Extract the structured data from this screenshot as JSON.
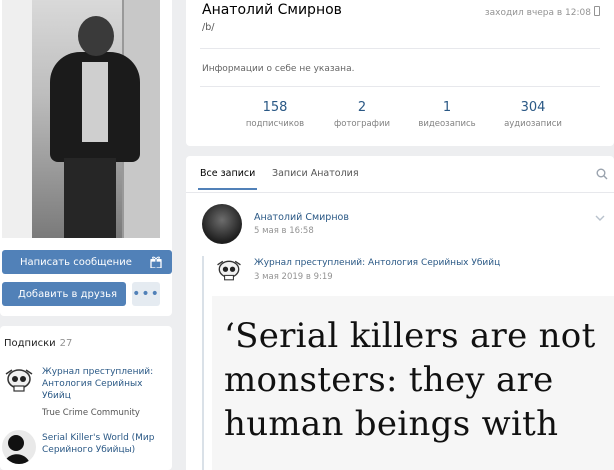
{
  "profile": {
    "name": "Анатолий Смирнов",
    "status": "/b/",
    "last_seen": "заходил вчера в 12:08",
    "about": "Информации о себе не указана.",
    "counters": [
      {
        "value": "158",
        "label": "подписчиков"
      },
      {
        "value": "2",
        "label": "фотографии"
      },
      {
        "value": "1",
        "label": "видеозапись"
      },
      {
        "value": "304",
        "label": "аудиозаписи"
      }
    ]
  },
  "actions": {
    "send_message": "Написать сообщение",
    "add_friend": "Добавить в друзья",
    "more": "•••"
  },
  "subscriptions": {
    "title": "Подписки",
    "count": "27",
    "items": [
      {
        "name": "Журнал преступлений: Антология Серийных Убийц",
        "desc": "True Crime Community"
      },
      {
        "name": "Serial Killer's World (Мир Серийного Убийцы)",
        "desc": ""
      }
    ]
  },
  "wall": {
    "tabs": [
      "Все записи",
      "Записи Анатолия"
    ],
    "post": {
      "author": "Анатолий Смирнов",
      "date": "5 мая в 16:58",
      "repost": {
        "author": "Журнал преступлений: Антология Серийных Убийц",
        "date": "3 мая 2019 в 9:19",
        "image_text": [
          "‘Serial killers are not",
          "monsters: they are",
          "human beings with"
        ]
      }
    }
  },
  "icons": {
    "gift": "gift-icon",
    "search": "search-icon",
    "chevron": "chevron-down-icon",
    "mobile": "mobile-icon"
  },
  "colors": {
    "accent": "#5181b8",
    "link": "#2a5885",
    "background": "#edeef0"
  }
}
